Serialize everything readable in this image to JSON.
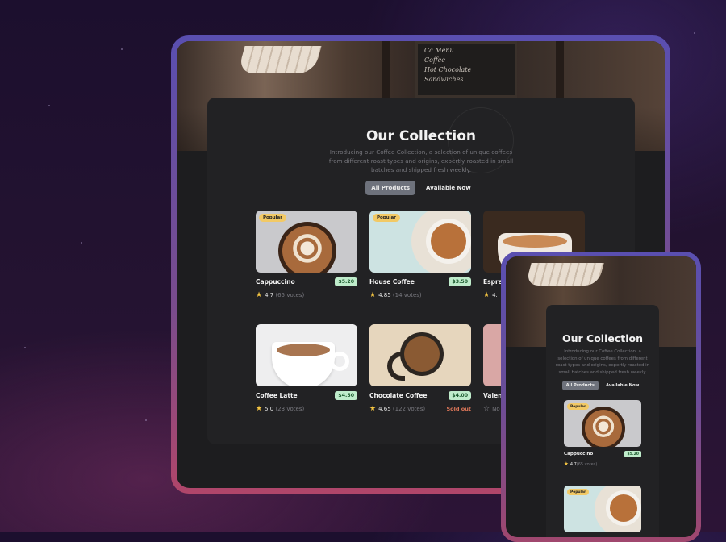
{
  "desktop": {
    "heading": "Our Collection",
    "description": "Introducing our Coffee Collection, a selection of unique coffees from different roast types and origins, expertly roasted in small batches and shipped fresh weekly.",
    "tabs": [
      {
        "label": "All Products",
        "active": true
      },
      {
        "label": "Available Now",
        "active": false
      }
    ],
    "products": [
      {
        "name": "Cappuccino",
        "price": "$5.20",
        "rating": "4.7",
        "votes": "(65 votes)",
        "badge": "Popular",
        "icon": "star-filled"
      },
      {
        "name": "House Coffee",
        "price": "$3.50",
        "rating": "4.85",
        "votes": "(14 votes)",
        "badge": "Popular",
        "icon": "star-filled"
      },
      {
        "name": "Espres",
        "rating": "4.",
        "icon": "star-filled"
      },
      {
        "name": "Coffee Latte",
        "price": "$4.50",
        "rating": "5.0",
        "votes": "(23 votes)",
        "icon": "star-filled"
      },
      {
        "name": "Chocolate Coffee",
        "price": "$4.00",
        "rating": "4.65",
        "votes": "(122 votes)",
        "status": "Sold out",
        "icon": "star-filled"
      },
      {
        "name": "Valen",
        "rating": "No",
        "icon": "star-empty"
      }
    ],
    "hero_board_text": [
      "Ca Menu",
      "Coffee",
      "Hot Chocolate",
      "Sandwiches"
    ]
  },
  "mobile": {
    "heading": "Our Collection",
    "description": "Introducing our Coffee Collection, a selection of unique coffees from different roast types and origins, expertly roasted in small batches and shipped fresh weekly.",
    "tabs": [
      {
        "label": "All Products",
        "active": true
      },
      {
        "label": "Available Now",
        "active": false
      }
    ],
    "products": [
      {
        "name": "Cappuccino",
        "price": "$5.20",
        "rating": "4.7",
        "votes": "(65 votes)",
        "badge": "Popular"
      },
      {
        "badge": "Popular"
      }
    ]
  },
  "colors": {
    "background": "#241331",
    "frame_top": "#5a4fb0",
    "frame_bottom": "#b0466a",
    "panel": "#222224",
    "badge": "#f2c965",
    "price_tag": "#bfeccb",
    "star": "#f5c542",
    "sold_out": "#e0785a"
  }
}
